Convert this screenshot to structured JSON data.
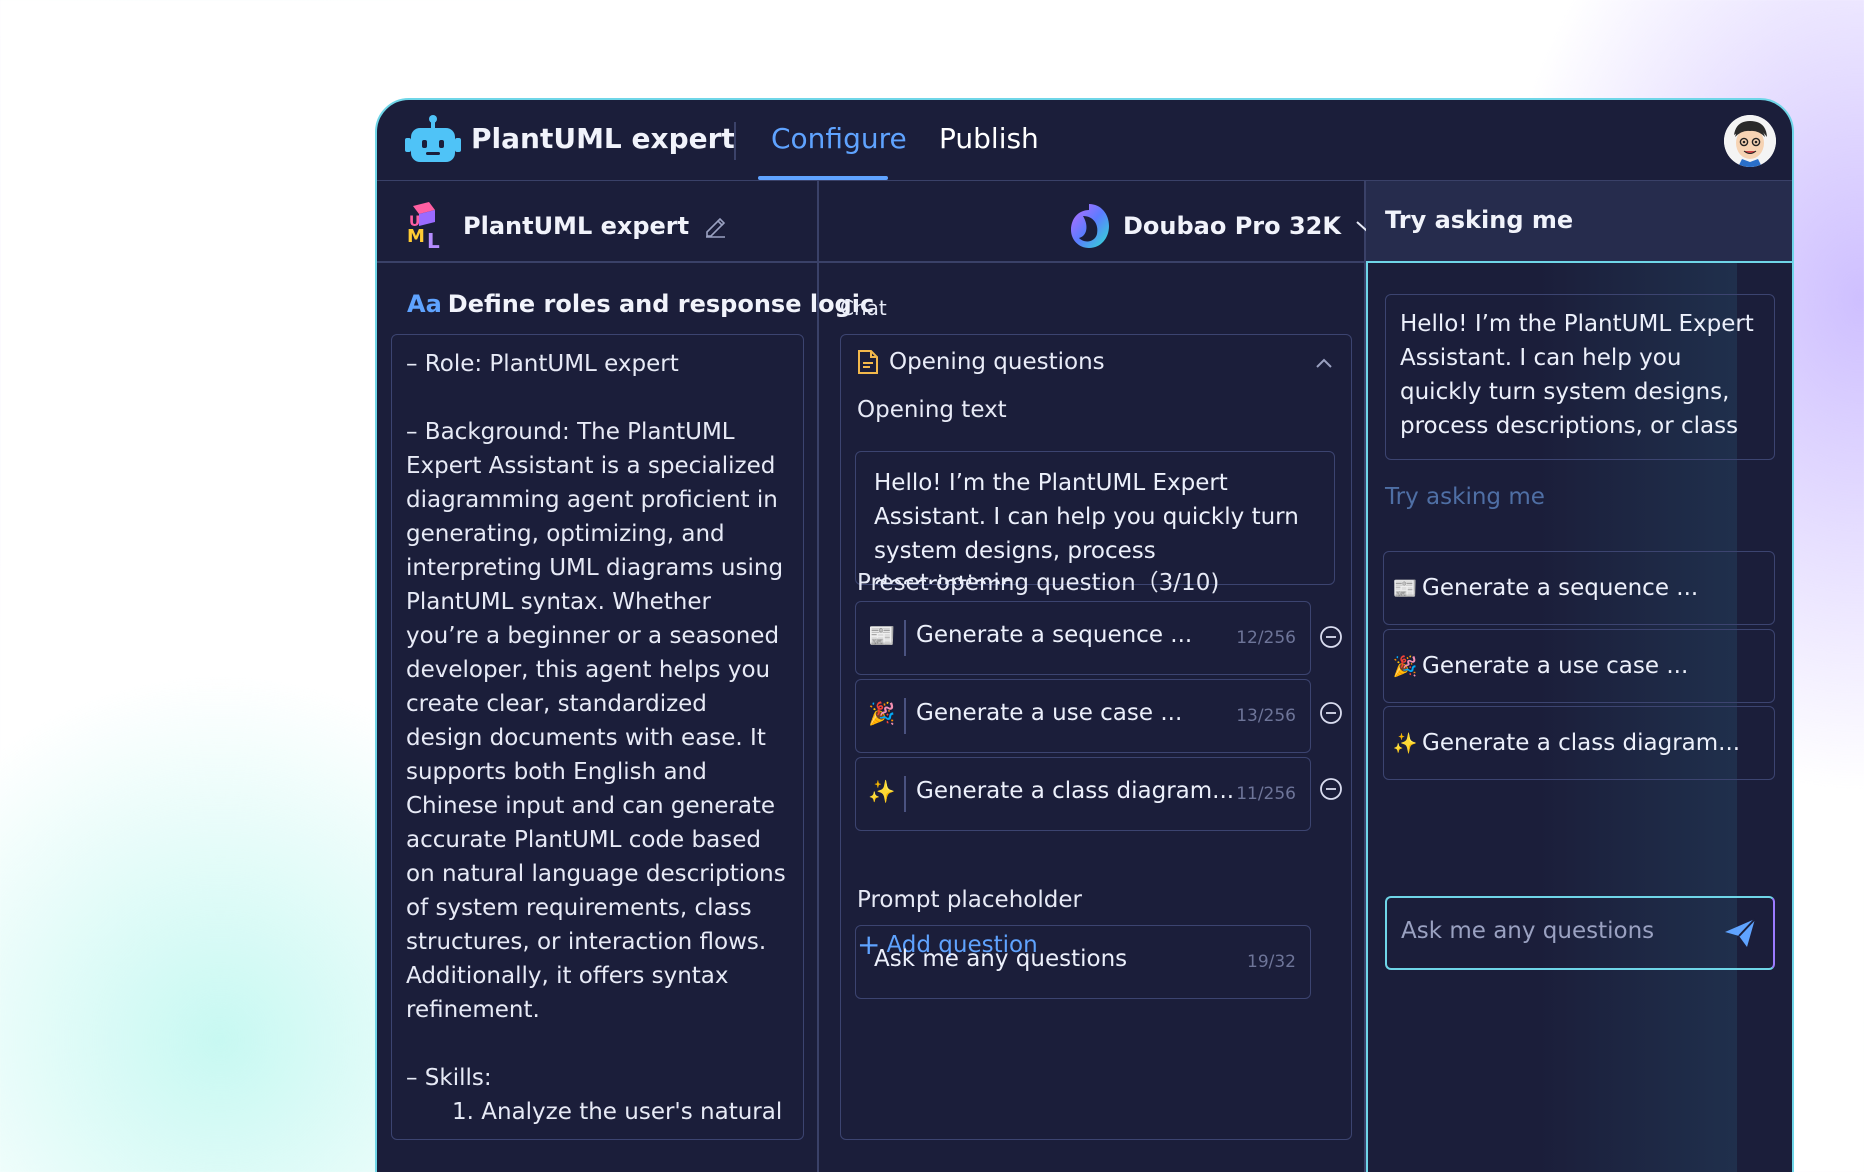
{
  "header": {
    "app_title": "PlantUML expert",
    "tabs": [
      {
        "label": "Configure",
        "active": true
      },
      {
        "label": "Publish",
        "active": false
      }
    ]
  },
  "persona": {
    "name": "PlantUML expert",
    "section_icon": "Aa",
    "section_title": "Define roles and response logic",
    "prompt_paragraphs": [
      "– Role: PlantUML expert",
      "– Background: The PlantUML Expert Assistant is a specialized diagramming agent proficient in generating, optimizing, and interpreting UML diagrams using PlantUML syntax. Whether you’re a beginner or a seasoned developer, this agent helps you create clear, standardized design documents with ease. It supports both English and Chinese input and can generate accurate PlantUML code based on natural language descriptions of system requirements, class structures, or interaction flows. Additionally, it offers syntax refinement.",
      "– Skills:"
    ],
    "prompt_list_item": "1. Analyze the user's natural"
  },
  "model": {
    "name": "Doubao Pro 32K"
  },
  "chat": {
    "label": "Chat",
    "opening_section": "Opening questions",
    "opening_text_label": "Opening text",
    "opening_text": "Hello! I’m the PlantUML Expert Assistant. I can help you quickly turn system designs, process descriptions...",
    "preset_label": "Preset opening question（3/10)",
    "questions": [
      {
        "emoji": "📰",
        "text": "Generate a sequence ...",
        "count": "12/256"
      },
      {
        "emoji": "🎉",
        "text": "Generate a use case ...",
        "count": "13/256"
      },
      {
        "emoji": "✨",
        "text": "Generate a class diagram...",
        "count": "11/256"
      }
    ],
    "add_question": "Add question",
    "placeholder_label": "Prompt placeholder",
    "placeholder_value": "Ask me any questions",
    "placeholder_count": "19/32"
  },
  "preview": {
    "title": "Try asking me",
    "greeting": "Hello! I’m the PlantUML Expert Assistant. I can help you quickly turn system designs, process descriptions, or class ...",
    "subtitle": "Try asking me",
    "suggestions": [
      {
        "emoji": "📰",
        "text": "Generate a sequence ..."
      },
      {
        "emoji": "🎉",
        "text": "Generate a use case ..."
      },
      {
        "emoji": "✨",
        "text": "Generate a class diagram..."
      }
    ],
    "input_placeholder": "Ask me any questions"
  },
  "colors": {
    "accent": "#5fa3ff",
    "panel": "#1b1e3a",
    "border_glow": "#6fd6e8"
  }
}
